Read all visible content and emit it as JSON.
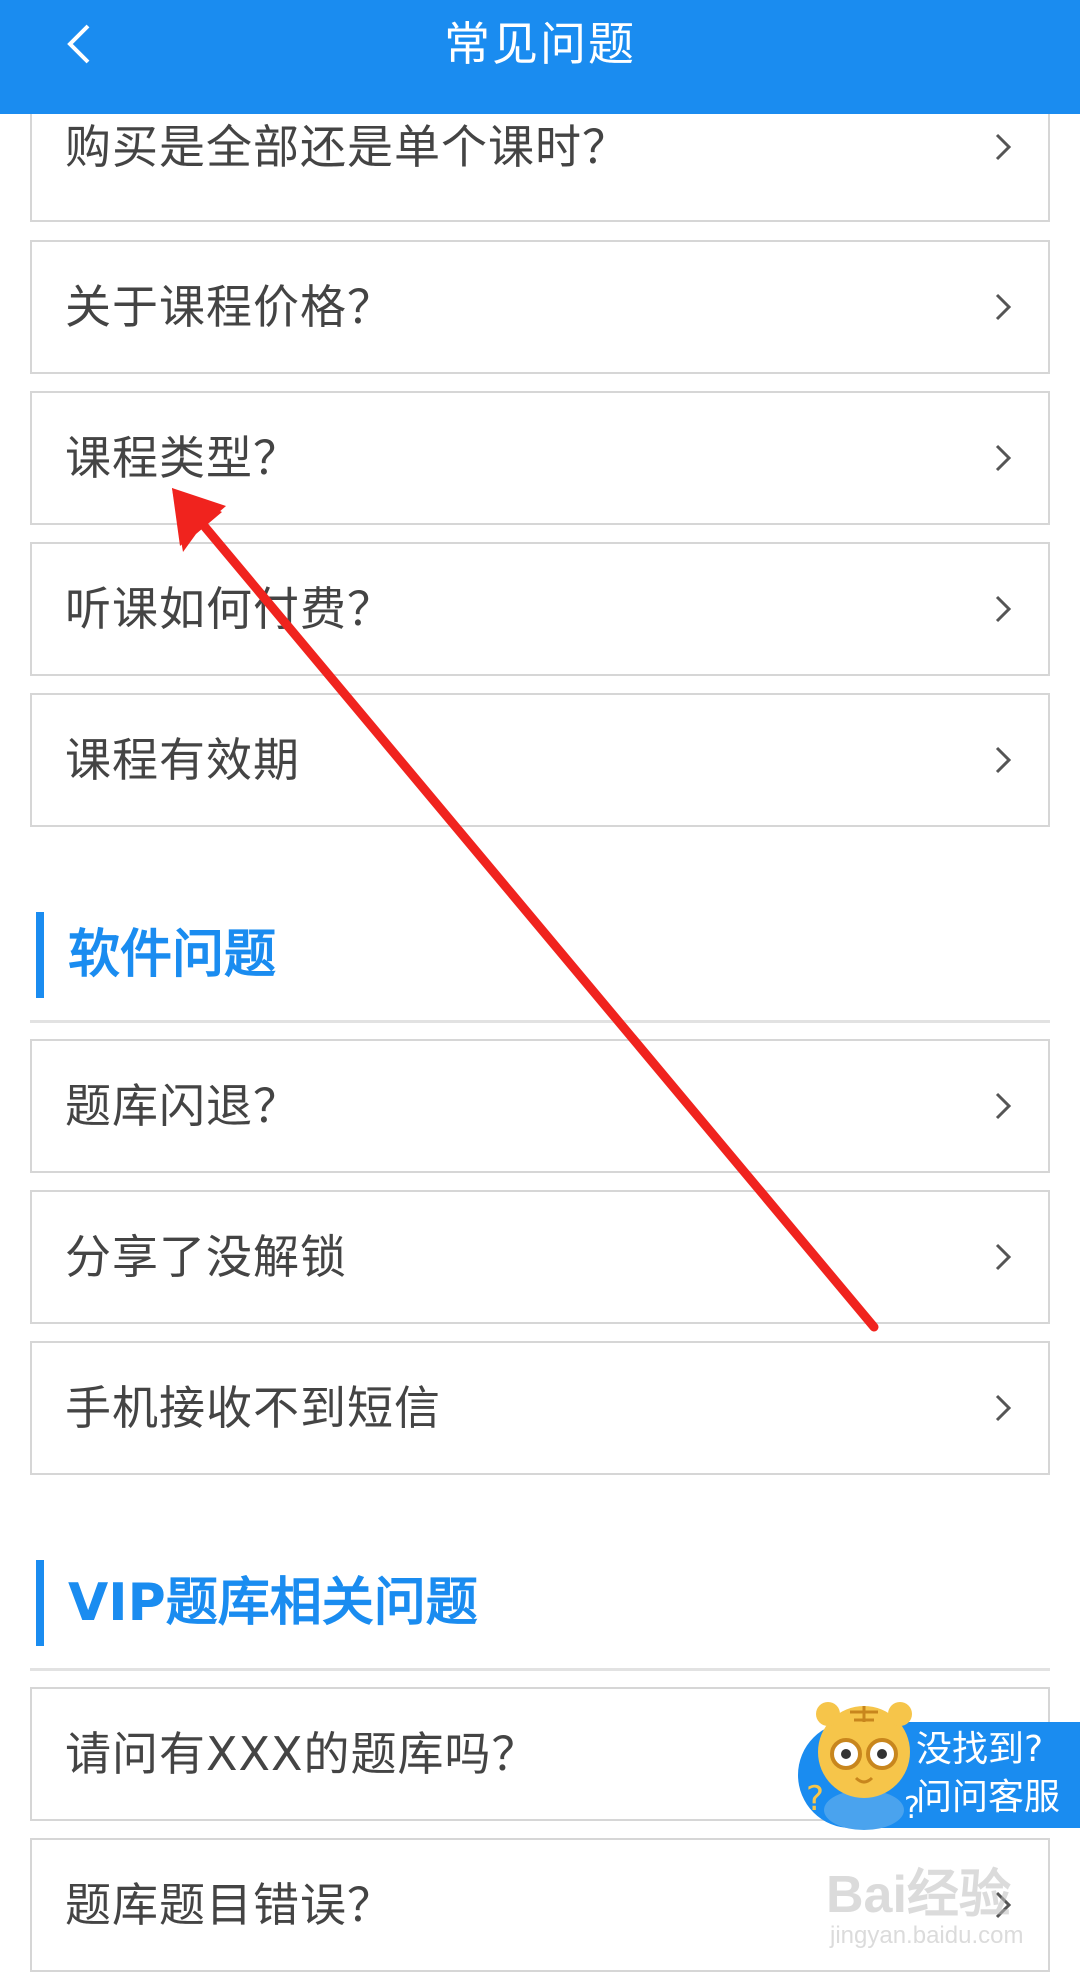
{
  "header": {
    "title": "常见问题",
    "back_icon": "chevron-left-icon"
  },
  "course_items": [
    {
      "label": "购买是全部还是单个课时？"
    },
    {
      "label": "关于课程价格？"
    },
    {
      "label": "课程类型？"
    },
    {
      "label": "听课如何付费？"
    },
    {
      "label": "课程有效期"
    }
  ],
  "software_section": {
    "title": "软件问题",
    "items": [
      {
        "label": "题库闪退？"
      },
      {
        "label": "分享了没解锁"
      },
      {
        "label": "手机接收不到短信"
      }
    ]
  },
  "vip_section": {
    "title": "VIP题库相关问题",
    "items": [
      {
        "label": "请问有XXX的题库吗？"
      },
      {
        "label": "题库题目错误？"
      }
    ]
  },
  "help_bubble": {
    "line1": "没找到?",
    "line2": "问问客服"
  },
  "watermark": {
    "brand": "Bai经验",
    "url": "jingyan.baidu.com"
  },
  "colors": {
    "accent": "#1a8cf0",
    "annotation_arrow": "#f0231e",
    "item_text": "#444444",
    "border": "#d6d6d6"
  }
}
